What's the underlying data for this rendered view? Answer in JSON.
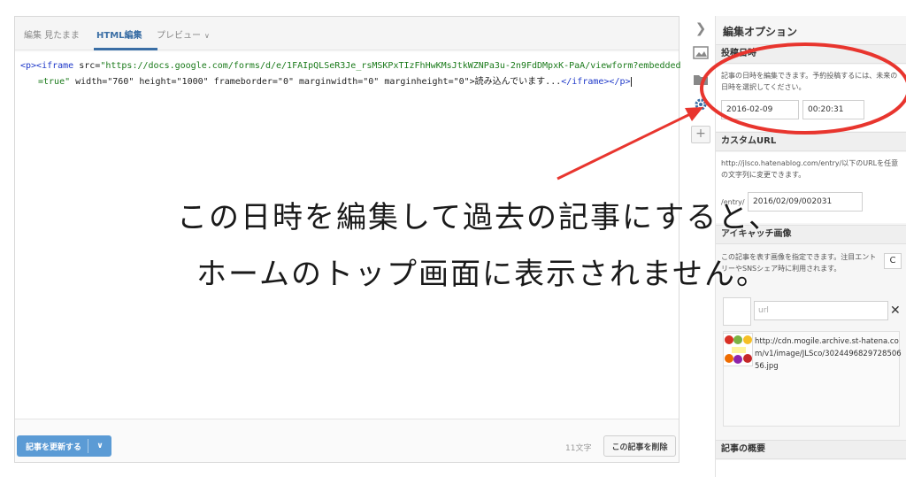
{
  "tabs": [
    {
      "label": "編集 見たまま"
    },
    {
      "label": "HTML編集"
    },
    {
      "label": "プレビュー"
    }
  ],
  "code": {
    "line1_tag_open": "<p><iframe",
    "line1_attr": " src=",
    "line1_src": "\"https://docs.google.com/forms/d/e/1FAIpQLSeR3Je_rsMSKPxTIzFhHwKMsJtkWZNPa3u-2n9FdDMpxK-PaA/viewform?embedded",
    "line2_src_end": "=true\"",
    "line2_rest": " width=\"760\" height=\"1000\" frameborder=\"0\" marginwidth=\"0\" marginheight=\"0\">読み込んでいます...",
    "line2_close": "</iframe></p>"
  },
  "footer": {
    "update_label": "記事を更新する",
    "char_count": "11文字",
    "delete_label": "この記事を削除"
  },
  "panel": {
    "title": "編集オプション",
    "datetime": {
      "heading": "投稿日時",
      "desc": "記事の日時を編集できます。予約投稿するには、未来の日時を選択してください。",
      "date": "2016-02-09",
      "time": "00:20:31"
    },
    "custom_url": {
      "heading": "カスタムURL",
      "desc": "http://jlsco.hatenablog.com/entry/以下のURLを任意の文字列に変更できます。",
      "prefix": "/entry/",
      "value": "2016/02/09/002031"
    },
    "eyecatch": {
      "heading": "アイキャッチ画像",
      "desc": "この記事を表す画像を指定できます。注目エントリーやSNSシェア時に利用されます。",
      "url_placeholder": "url",
      "clear_label": "✕",
      "reload_label": "C",
      "image_url": "http://cdn.mogile.archive.st-hatena.com/v1/image/JLSco/302449682972850656.jpg"
    },
    "summary": {
      "heading": "記事の概要"
    }
  },
  "annotation": {
    "line1": "この日時を編集して過去の記事にすると、",
    "line2": "ホームのトップ画面に表示されません。"
  },
  "colors": {
    "accent": "#3a6ea5",
    "update_button": "#5b9bd5",
    "annotation_red": "#e8352e"
  }
}
